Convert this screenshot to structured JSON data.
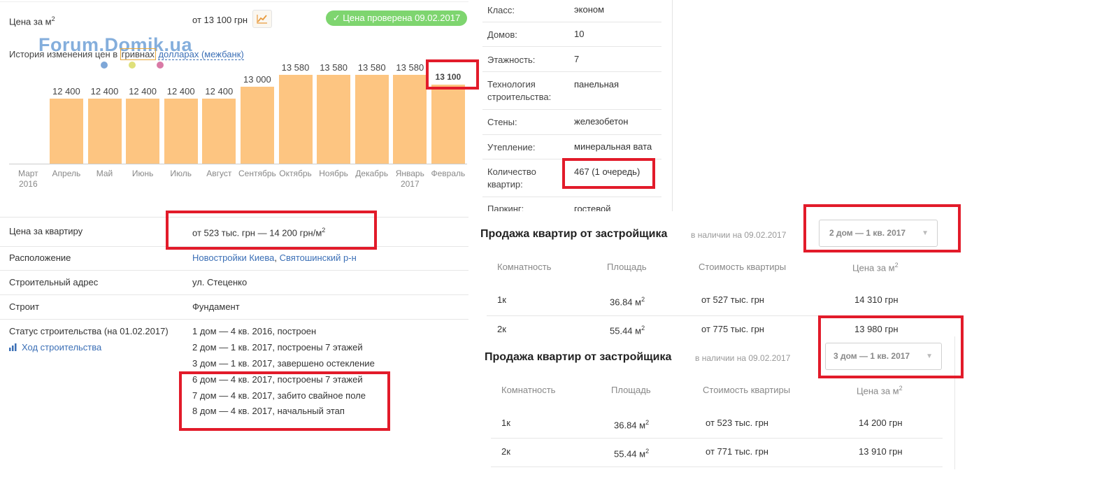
{
  "left": {
    "price_m2_label": "Цена за м",
    "price_m2_sup": "2",
    "price_m2_value": "от 13 100 грн",
    "verified_badge": "✓ Цена проверена 09.02.2017",
    "history_label_pre": "История изменения цен в ",
    "history_currency_uah": "гривнах",
    "history_currency_usd": "долларах (межбанк)",
    "watermark": "Forum.Domik.ua",
    "accent_colors": {
      "bar": "#fdc581",
      "badge": "#7ed56f",
      "link": "#3b6fb6",
      "highlight": "#e21b2a"
    },
    "details": {
      "apartment_price_label": "Цена за квартиру",
      "apartment_price_value": "от 523 тыс. грн — 14 200 грн/м",
      "apartment_price_sup": "2",
      "location_label": "Расположение",
      "location_link1": "Новостройки Киева",
      "location_sep": ", ",
      "location_link2": "Святошинский р-н",
      "address_label": "Строительный адрес",
      "address_value": "ул. Стеценко",
      "builder_label": "Строит",
      "builder_value": "Фундамент",
      "status_label": "Статус строительства (на 01.02.2017)",
      "progress_link": "Ход строительства",
      "status_lines": [
        "1 дом — 4 кв. 2016, построен",
        "2 дом — 1 кв. 2017, построены 7 этажей",
        "3 дом — 1 кв. 2017, завершено остекление",
        "6 дом — 4 кв. 2017, построены 7 этажей",
        "7 дом — 4 кв. 2017, забито свайное поле",
        "8 дом — 4 кв. 2017, начальный этап"
      ]
    }
  },
  "chart_data": {
    "type": "bar",
    "categories": [
      "Март 2016",
      "Апрель",
      "Май",
      "Июнь",
      "Июль",
      "Август",
      "Сентябрь",
      "Октябрь",
      "Ноябрь",
      "Декабрь",
      "Январь 2017",
      "Февраль"
    ],
    "month_lines": [
      [
        "Март",
        "2016"
      ],
      [
        "Апрель"
      ],
      [
        "Май"
      ],
      [
        "Июнь"
      ],
      [
        "Июль"
      ],
      [
        "Август"
      ],
      [
        "Сентябрь"
      ],
      [
        "Октябрь"
      ],
      [
        "Ноябрь"
      ],
      [
        "Декабрь"
      ],
      [
        "Январь",
        "2017"
      ],
      [
        "Февраль"
      ]
    ],
    "values": [
      null,
      12400,
      12400,
      12400,
      12400,
      12400,
      13000,
      13580,
      13580,
      13580,
      13580,
      13100
    ],
    "labels": [
      "",
      "12 400",
      "12 400",
      "12 400",
      "12 400",
      "12 400",
      "13 000",
      "13 580",
      "13 580",
      "13 580",
      "13 580",
      "13 100"
    ]
  },
  "specs": [
    {
      "label": "Класс:",
      "value": "эконом"
    },
    {
      "label": "Домов:",
      "value": "10"
    },
    {
      "label": "Этажность:",
      "value": "7"
    },
    {
      "label": "Технология строительства:",
      "value": "панельная"
    },
    {
      "label": "Стены:",
      "value": "железобетон"
    },
    {
      "label": "Утепление:",
      "value": "минеральная вата"
    },
    {
      "label": "Количество квартир:",
      "value": "467 (1 очередь)"
    },
    {
      "label": "Паркинг:",
      "value": "гостевой"
    }
  ],
  "sales": [
    {
      "title": "Продажа квартир от застройщика",
      "subtitle": "в наличии на 09.02.2017",
      "select": "2 дом — 1 кв. 2017",
      "headers": [
        "Комнатность",
        "Площадь",
        "Стоимость квартиры",
        "Цена за м"
      ],
      "rows": [
        [
          "1к",
          "36.84 м",
          "от 527 тыс. грн",
          "14 310 грн"
        ],
        [
          "2к",
          "55.44 м",
          "от 775 тыс. грн",
          "13 980 грн"
        ]
      ]
    },
    {
      "title": "Продажа квартир от застройщика",
      "subtitle": "в наличии на 09.02.2017",
      "select": "3 дом — 1 кв. 2017",
      "headers": [
        "Комнатность",
        "Площадь",
        "Стоимость квартиры",
        "Цена за м"
      ],
      "rows": [
        [
          "1к",
          "36.84 м",
          "от 523 тыс. грн",
          "14 200 грн"
        ],
        [
          "2к",
          "55.44 м",
          "от 771 тыс. грн",
          "13 910 грн"
        ]
      ]
    }
  ]
}
